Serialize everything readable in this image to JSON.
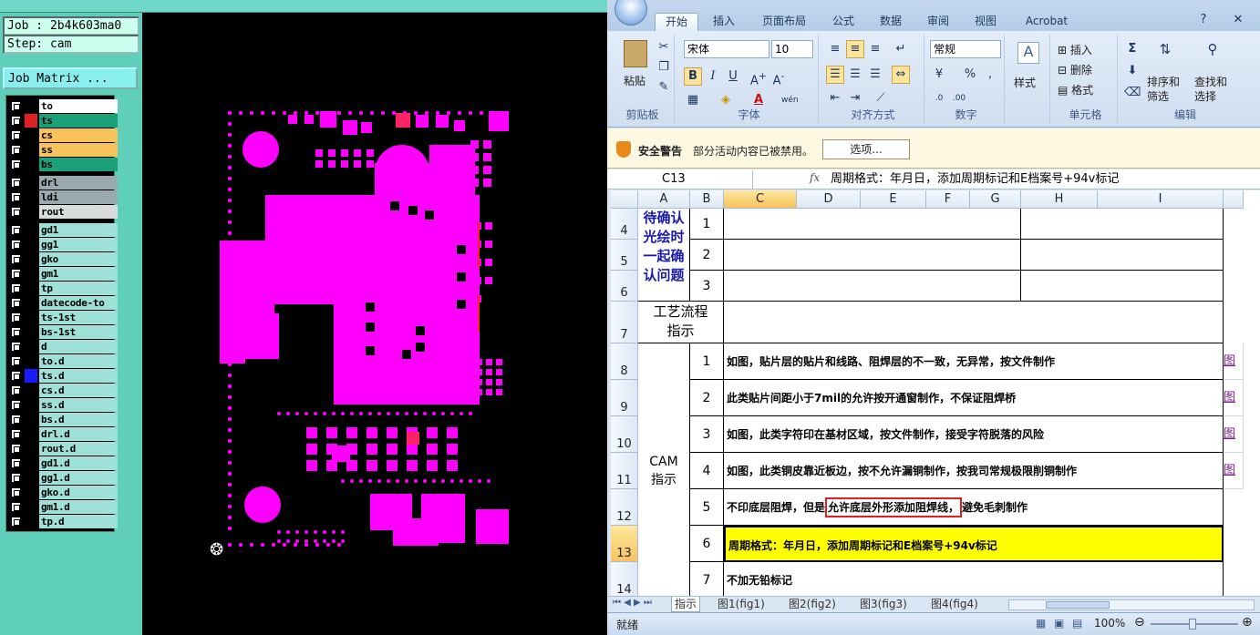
{
  "genesis": {
    "job_label": "Job : 2b4k603ma0",
    "step_label": "Step: cam",
    "job_matrix_button": "Job Matrix ...",
    "layers": [
      {
        "name": "to",
        "color": "#ffffff",
        "swatch": "#000000"
      },
      {
        "name": "ts",
        "color": "#1aa17a",
        "swatch": "#e02020"
      },
      {
        "name": "cs",
        "color": "#f7c35a",
        "swatch": "#000000"
      },
      {
        "name": "ss",
        "color": "#f7c35a",
        "swatch": "#000000"
      },
      {
        "name": "bs",
        "color": "#1aa17a",
        "swatch": "#000000"
      },
      {
        "name": "drl",
        "color": "#9aa9ad",
        "swatch": "#000000"
      },
      {
        "name": "ldi",
        "color": "#9aa9ad",
        "swatch": "#000000"
      },
      {
        "name": "rout",
        "color": "#d8dcdd",
        "swatch": "#000000"
      },
      {
        "name": "gd1",
        "color": "#9fe0d8",
        "swatch": "#000000"
      },
      {
        "name": "gg1",
        "color": "#9fe0d8",
        "swatch": "#000000"
      },
      {
        "name": "gko",
        "color": "#9fe0d8",
        "swatch": "#000000"
      },
      {
        "name": "gm1",
        "color": "#9fe0d8",
        "swatch": "#000000"
      },
      {
        "name": "tp",
        "color": "#9fe0d8",
        "swatch": "#000000"
      },
      {
        "name": "datecode-to",
        "color": "#9fe0d8",
        "swatch": "#000000"
      },
      {
        "name": "ts-1st",
        "color": "#9fe0d8",
        "swatch": "#000000"
      },
      {
        "name": "bs-1st",
        "color": "#9fe0d8",
        "swatch": "#000000"
      },
      {
        "name": "d",
        "color": "#9fe0d8",
        "swatch": "#000000"
      },
      {
        "name": "to.d",
        "color": "#9fe0d8",
        "swatch": "#000000"
      },
      {
        "name": "ts.d",
        "color": "#9fe0d8",
        "swatch": "#1a1aff"
      },
      {
        "name": "cs.d",
        "color": "#9fe0d8",
        "swatch": "#000000"
      },
      {
        "name": "ss.d",
        "color": "#9fe0d8",
        "swatch": "#000000"
      },
      {
        "name": "bs.d",
        "color": "#9fe0d8",
        "swatch": "#000000"
      },
      {
        "name": "drl.d",
        "color": "#9fe0d8",
        "swatch": "#000000"
      },
      {
        "name": "rout.d",
        "color": "#9fe0d8",
        "swatch": "#000000"
      },
      {
        "name": "gd1.d",
        "color": "#9fe0d8",
        "swatch": "#000000"
      },
      {
        "name": "gg1.d",
        "color": "#9fe0d8",
        "swatch": "#000000"
      },
      {
        "name": "gko.d",
        "color": "#9fe0d8",
        "swatch": "#000000"
      },
      {
        "name": "gm1.d",
        "color": "#9fe0d8",
        "swatch": "#000000"
      },
      {
        "name": "tp.d",
        "color": "#9fe0d8",
        "swatch": "#000000"
      }
    ],
    "pcb_color": "#ff00ff"
  },
  "excel": {
    "tabs": [
      "开始",
      "插入",
      "页面布局",
      "公式",
      "数据",
      "审阅",
      "视图",
      "Acrobat"
    ],
    "font_name": "宋体",
    "font_size": "10",
    "number_format": "常规",
    "clipboard": {
      "paste": "粘贴",
      "label": "剪贴板"
    },
    "font_group_label": "字体",
    "align_group_label": "对齐方式",
    "number_group_label": "数字",
    "styles_label": "样式",
    "cells_group": {
      "insert": "插入",
      "delete": "删除",
      "format": "格式",
      "label": "单元格"
    },
    "edit_group": {
      "sort": "排序和筛选",
      "find": "查找和选择",
      "label": "编辑"
    },
    "security": {
      "title": "安全警告",
      "message": "部分活动内容已被禁用。",
      "options": "选项..."
    },
    "name_box": "C13",
    "formula": "周期格式：年月日，添加周期标记和E档案号+94v标记",
    "columns": [
      "A",
      "B",
      "C",
      "D",
      "E",
      "F",
      "G",
      "H",
      "I"
    ],
    "rows": [
      {
        "num": "4",
        "b": "1"
      },
      {
        "num": "5",
        "b": "2"
      },
      {
        "num": "6",
        "b": "3"
      },
      {
        "num": "7"
      },
      {
        "num": "8",
        "b": "1",
        "c": "如图，贴片层的贴片和线路、阻焊层的不一致，无异常，按文件制作",
        "j": "图"
      },
      {
        "num": "9",
        "b": "2",
        "c": "此类贴片间距小于7mil的允许按开通窗制作，不保证阻焊桥",
        "j": "图"
      },
      {
        "num": "10",
        "b": "3",
        "c": "如图，此类字符印在基材区域，按文件制作，接受字符脱落的风险",
        "j": "图"
      },
      {
        "num": "11",
        "b": "4",
        "c": "如图，此类铜皮靠近板边，按不允许漏铜制作，按我司常规极限削铜制作",
        "j": "图"
      },
      {
        "num": "12",
        "b": "5",
        "c1": "不印底层阻焊，但是",
        "c2": "允许底层外形添加阻焊线，",
        "c3": "避免毛刺制作"
      },
      {
        "num": "13",
        "b": "6",
        "c": "周期格式：年月日，添加周期标记和E档案号+94v标记"
      },
      {
        "num": "14",
        "b": "7",
        "c": "不加无铅标记"
      }
    ],
    "a_pending": "待确认光绘时一起确认问题",
    "a_process": "工艺流程指示",
    "a_cam": "CAM指示",
    "sheet_tabs": [
      "指示",
      "图1(fig1)",
      "图2(fig2)",
      "图3(fig3)",
      "图4(fig4)"
    ],
    "status": "就绪",
    "zoom": "100%"
  }
}
